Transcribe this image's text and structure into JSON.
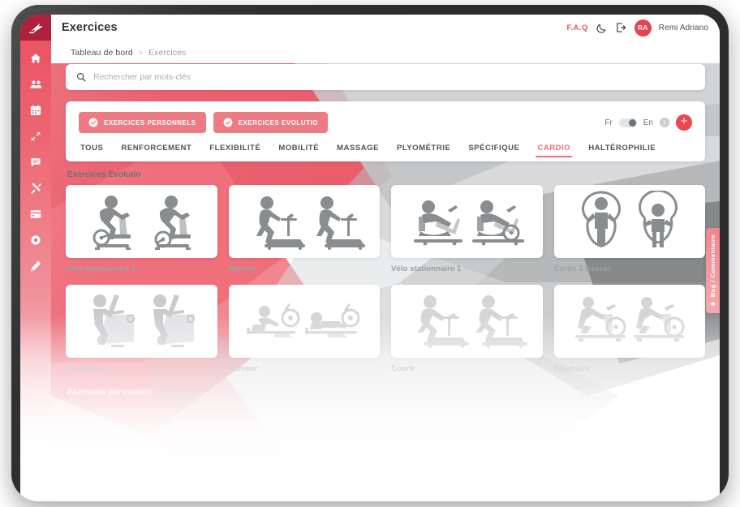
{
  "brand": {
    "logo_icon": "flash-logo-icon",
    "accent_red": "#e8505f",
    "accent_red_dark": "#b01f3c",
    "chip_red": "#ee7b84",
    "add_red": "#f0444f"
  },
  "sidebar": {
    "items": [
      {
        "icon": "home-icon",
        "name": "sidebar-item-home"
      },
      {
        "icon": "people-icon",
        "name": "sidebar-item-patients"
      },
      {
        "icon": "calendar-icon",
        "name": "sidebar-item-calendar"
      },
      {
        "icon": "expand-icon",
        "name": "sidebar-item-exercises"
      },
      {
        "icon": "chat-icon",
        "name": "sidebar-item-messages"
      },
      {
        "icon": "tools-icon",
        "name": "sidebar-item-tools"
      },
      {
        "icon": "card-icon",
        "name": "sidebar-item-billing"
      },
      {
        "icon": "gear-icon",
        "name": "sidebar-item-settings"
      },
      {
        "icon": "pencil-icon",
        "name": "sidebar-item-edit"
      }
    ]
  },
  "header": {
    "title": "Exercices",
    "faq_label": "F.A.Q",
    "moon_icon": "moon-icon",
    "logout_icon": "logout-icon",
    "avatar_initials": "RA",
    "user_name": "Remi Adriano"
  },
  "breadcrumb": {
    "root": "Tableau de bord",
    "separator": ">",
    "current": "Exercices"
  },
  "search": {
    "icon": "search-icon",
    "placeholder": "Rechercher par mots-clés",
    "value": ""
  },
  "panel": {
    "chips": [
      {
        "label": "EXERCICES PERSONNELS",
        "icon": "check-circle-icon",
        "active": true
      },
      {
        "label": "EXERCICES EVOLUTIO",
        "icon": "check-circle-icon",
        "active": true
      }
    ],
    "lang_left": "Fr",
    "lang_right": "En",
    "lang_toggle_state": "En",
    "info_icon": "info-icon",
    "info_label": "i",
    "add_button_icon": "plus-icon",
    "add_button_label": "+",
    "tabs": [
      {
        "label": "TOUS",
        "active": false
      },
      {
        "label": "RENFORCEMENT",
        "active": false
      },
      {
        "label": "FLEXIBILITÉ",
        "active": false
      },
      {
        "label": "MOBILITÉ",
        "active": false
      },
      {
        "label": "MASSAGE",
        "active": false
      },
      {
        "label": "PLYOMÉTRIE",
        "active": false
      },
      {
        "label": "SPÉCIFIQUE",
        "active": false
      },
      {
        "label": "CARDIO",
        "active": true
      },
      {
        "label": "HALTÉROPHILIE",
        "active": false
      }
    ]
  },
  "sections": [
    {
      "title": "Exercices Evolutio",
      "rows": [
        [
          {
            "label": "Vélo stationnaire 2",
            "icon": "upright-bike-icon"
          },
          {
            "label": "Marche",
            "icon": "treadmill-walk-icon"
          },
          {
            "label": "Vélo stationnaire 1",
            "icon": "recumbent-bike-icon"
          },
          {
            "label": "Corde à danser",
            "icon": "jump-rope-icon"
          }
        ],
        [
          {
            "label": "Escaladeur",
            "icon": "stair-climber-icon"
          },
          {
            "label": "Rameur",
            "icon": "rowing-machine-icon"
          },
          {
            "label": "Courir",
            "icon": "treadmill-run-icon"
          },
          {
            "label": "Elliptique",
            "icon": "elliptical-icon"
          }
        ]
      ]
    },
    {
      "title": "Exercices personnels",
      "rows": []
    }
  ],
  "feedback_tab": {
    "label": "Bug / Commentaire",
    "icon": "bug-icon"
  }
}
